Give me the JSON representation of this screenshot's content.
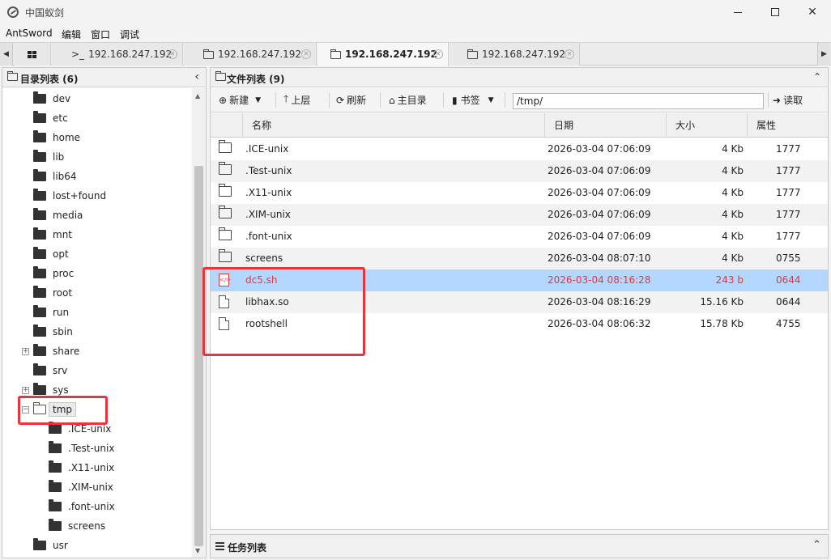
{
  "window": {
    "title": "中国蚁剑"
  },
  "menu": [
    "AntSword",
    "编辑",
    "窗口",
    "调试"
  ],
  "tabs": [
    {
      "label": "192.168.247.192",
      "icon": "terminal-icon",
      "prefix": ">_"
    },
    {
      "label": "192.168.247.192",
      "icon": "folder-icon"
    },
    {
      "label": "192.168.247.192",
      "icon": "folder-icon"
    },
    {
      "label": "192.168.247.192",
      "icon": "folder-icon"
    }
  ],
  "dir_panel": {
    "title": "目录列表 (6)",
    "items": [
      {
        "label": "dev"
      },
      {
        "label": "etc"
      },
      {
        "label": "home"
      },
      {
        "label": "lib"
      },
      {
        "label": "lib64"
      },
      {
        "label": "lost+found"
      },
      {
        "label": "media"
      },
      {
        "label": "mnt"
      },
      {
        "label": "opt"
      },
      {
        "label": "proc"
      },
      {
        "label": "root"
      },
      {
        "label": "run"
      },
      {
        "label": "sbin"
      },
      {
        "label": "share"
      },
      {
        "label": "srv"
      },
      {
        "label": "sys"
      },
      {
        "label": "tmp"
      },
      {
        "label": ".ICE-unix"
      },
      {
        "label": ".Test-unix"
      },
      {
        "label": ".X11-unix"
      },
      {
        "label": ".XIM-unix"
      },
      {
        "label": ".font-unix"
      },
      {
        "label": "screens"
      },
      {
        "label": "usr"
      }
    ]
  },
  "file_panel": {
    "title": "文件列表 (9)",
    "toolbar": {
      "new": "新建",
      "up": "上层",
      "refresh": "刷新",
      "home": "主目录",
      "bookmark": "书签",
      "path": "/tmp/",
      "read": "读取"
    },
    "columns": {
      "name": "名称",
      "date": "日期",
      "size": "大小",
      "attr": "属性"
    },
    "rows": [
      {
        "name": ".ICE-unix",
        "date": "2026-03-04 07:06:09",
        "size": "4 Kb",
        "attr": "1777"
      },
      {
        "name": ".Test-unix",
        "date": "2026-03-04 07:06:09",
        "size": "4 Kb",
        "attr": "1777"
      },
      {
        "name": ".X11-unix",
        "date": "2026-03-04 07:06:09",
        "size": "4 Kb",
        "attr": "1777"
      },
      {
        "name": ".XIM-unix",
        "date": "2026-03-04 07:06:09",
        "size": "4 Kb",
        "attr": "1777"
      },
      {
        "name": ".font-unix",
        "date": "2026-03-04 07:06:09",
        "size": "4 Kb",
        "attr": "1777"
      },
      {
        "name": "screens",
        "date": "2026-03-04 08:07:10",
        "size": "4 Kb",
        "attr": "0755"
      },
      {
        "name": "dc5.sh",
        "date": "2026-03-04 08:16:28",
        "size": "243 b",
        "attr": "0644"
      },
      {
        "name": "libhax.so",
        "date": "2026-03-04 08:16:29",
        "size": "15.16 Kb",
        "attr": "0644"
      },
      {
        "name": "rootshell",
        "date": "2026-03-04 08:06:32",
        "size": "15.78 Kb",
        "attr": "4755"
      }
    ]
  },
  "task_panel": {
    "title": "任务列表"
  },
  "colors": {
    "highlight": "#e8343a",
    "selected_row": "#b3d7ff"
  }
}
